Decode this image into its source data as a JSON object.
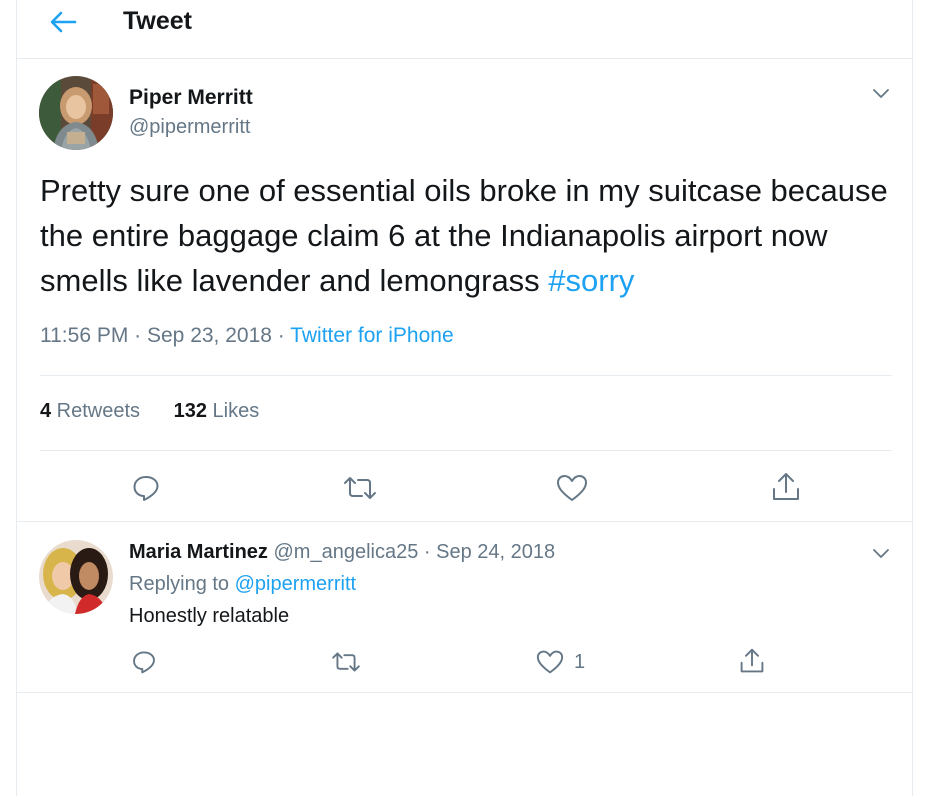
{
  "header": {
    "title": "Tweet",
    "back_icon": "arrow-left-icon"
  },
  "tweet": {
    "author_name": "Piper Merritt",
    "author_handle": "@pipermerritt",
    "text": "Pretty sure one of essential oils broke in my suitcase because the entire baggage claim 6 at the Indianapolis airport now smells like lavender and lemongrass ",
    "hashtag": "#sorry",
    "timestamp": "11:56 PM · Sep 23, 2018 · ",
    "source": "Twitter for iPhone",
    "retweets_count": "4",
    "retweets_label": " Retweets",
    "likes_count": "132",
    "likes_label": " Likes"
  },
  "reply": {
    "author_name": "Maria Martinez",
    "author_handle_date": " @m_angelica25 · Sep 24, 2018",
    "replying_label": "Replying to ",
    "replying_to": "@pipermerritt",
    "text": "Honestly relatable",
    "like_count": "1"
  },
  "colors": {
    "accent": "#1da1f2",
    "secondary_text": "#657786",
    "primary_text": "#14171a",
    "border": "#e6ecf0"
  }
}
